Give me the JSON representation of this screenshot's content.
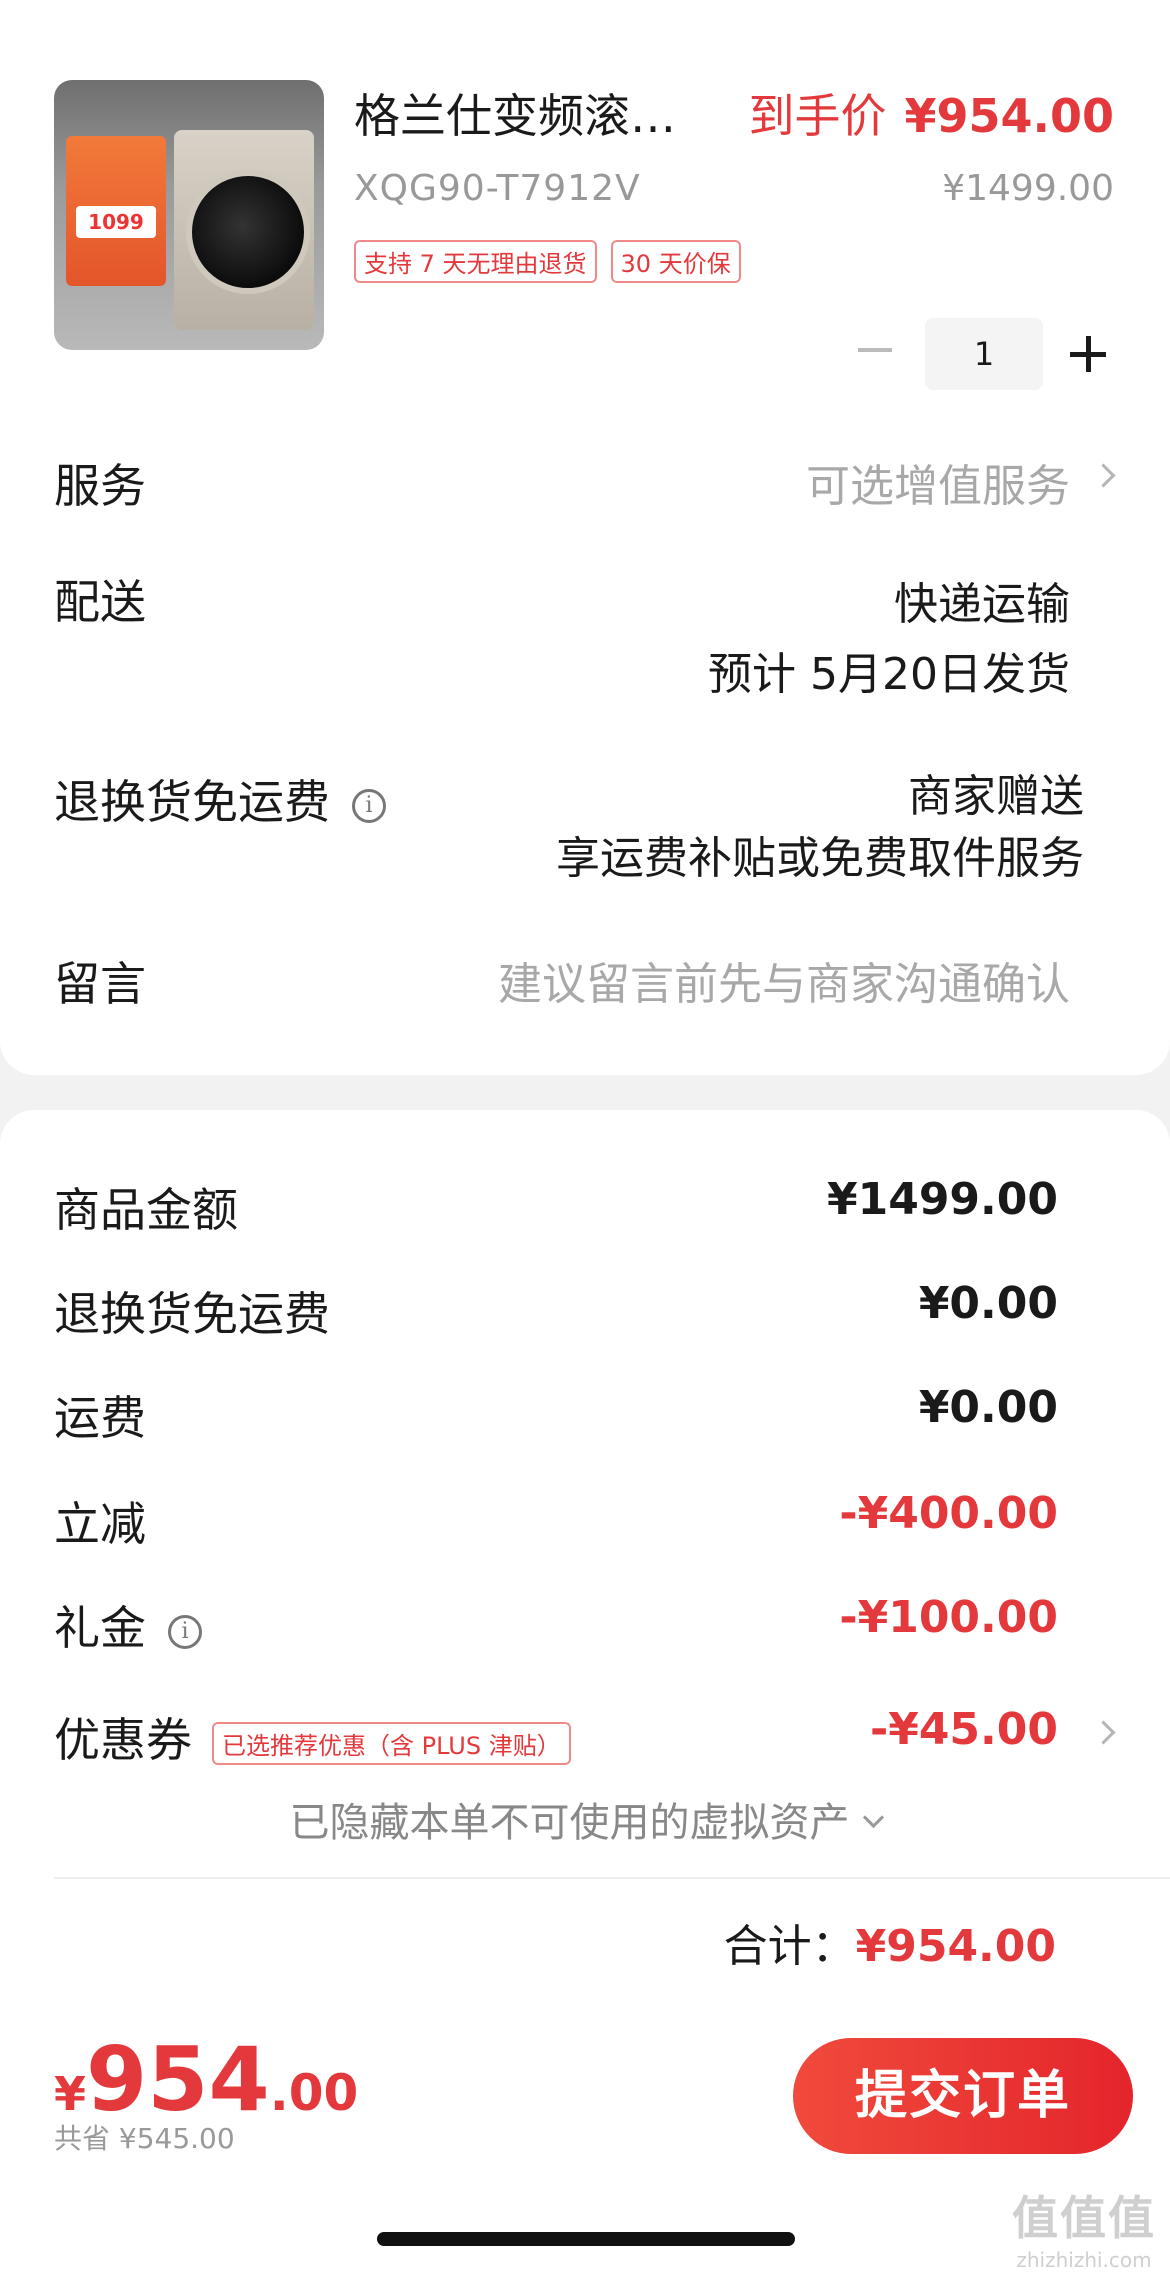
{
  "product": {
    "image_alt": "washing-machine-thumbnail",
    "poster_price": "1099",
    "title": "格兰仕变频滚…",
    "final_price_label": "到手价",
    "final_price": "¥954.00",
    "model": "XQG90-T7912V",
    "original_price": "¥1499.00",
    "tags": [
      "支持 7 天无理由退货",
      "30 天价保"
    ],
    "quantity": "1"
  },
  "rows": {
    "service": {
      "label": "服务",
      "value": "可选增值服务"
    },
    "delivery": {
      "label": "配送",
      "line1": "快递运输",
      "line2": "预计 5月20日发货"
    },
    "return_shipping": {
      "label": "退换货免运费",
      "line1": "商家赠送",
      "line2": "享运费补贴或免费取件服务"
    },
    "message": {
      "label": "留言",
      "placeholder": "建议留言前先与商家沟通确认"
    }
  },
  "summary": {
    "goods_amount": {
      "label": "商品金额",
      "value": "¥1499.00"
    },
    "return_fee": {
      "label": "退换货免运费",
      "value": "¥0.00"
    },
    "shipping": {
      "label": "运费",
      "value": "¥0.00"
    },
    "instant_discount": {
      "label": "立减",
      "value": "-¥400.00"
    },
    "gift_money": {
      "label": "礼金",
      "value": "-¥100.00"
    },
    "coupon": {
      "label": "优惠券",
      "tag": "已选推荐优惠（含 PLUS 津贴）",
      "value": "-¥45.00"
    },
    "hidden_assets": "已隐藏本单不可使用的虚拟资产",
    "total_label": "合计：",
    "total_value": "¥954.00"
  },
  "bottom": {
    "currency": "¥",
    "price_int": "954",
    "price_dec": ".00",
    "saved": "共省 ¥545.00",
    "submit_label": "提交订单"
  },
  "watermark": {
    "logo": "值值值",
    "site": "zhizhizhi.com"
  },
  "colors": {
    "accent": "#e4393c",
    "muted": "#a8a8a8",
    "background": "#f2f2f2"
  }
}
